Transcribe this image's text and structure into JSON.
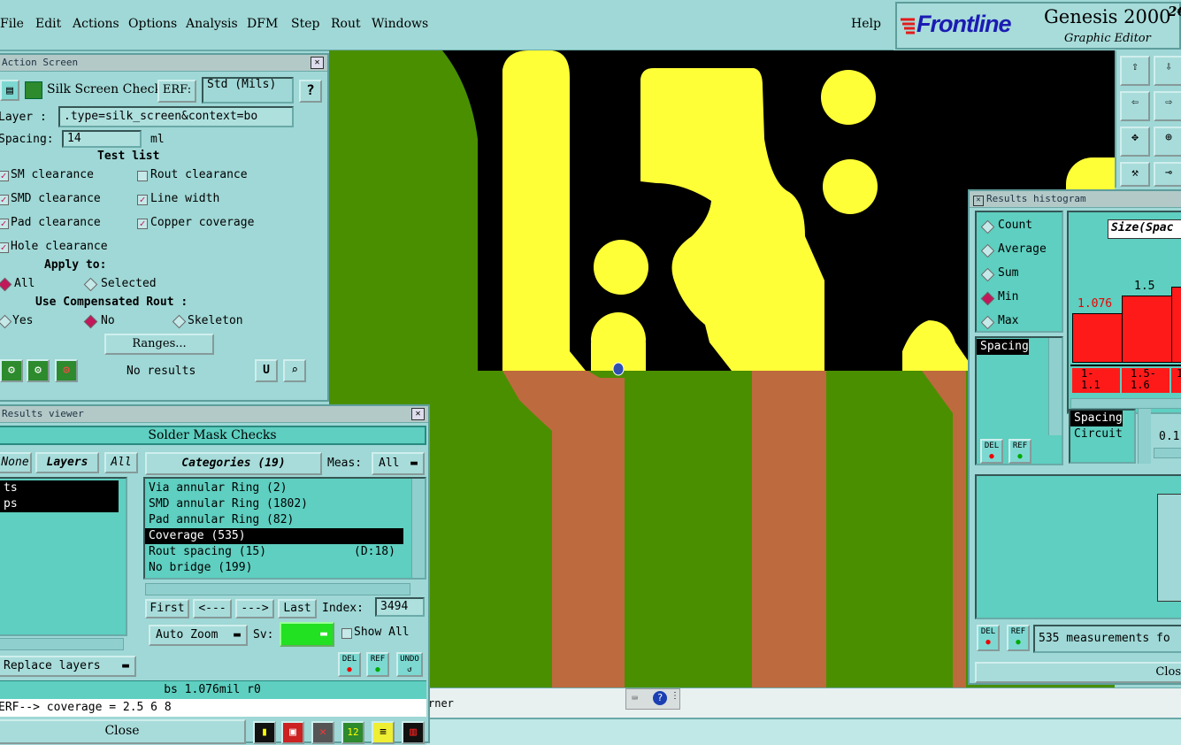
{
  "menubar": {
    "items": [
      "File",
      "Edit",
      "Actions",
      "Options",
      "Analysis",
      "DFM",
      "Step",
      "Rout",
      "Windows"
    ],
    "help": "Help"
  },
  "brand": {
    "logo": "Frontline",
    "product": "Genesis 2000",
    "version_fragment": "2€",
    "subtitle": "Graphic Editor"
  },
  "action_screen": {
    "title": "Action Screen",
    "check_name": "Silk Screen Checks",
    "erf_label": "ERF:",
    "erf_value": "Std (Mils)",
    "help_btn": "?",
    "layer_label": "Layer :",
    "layer_value": ".type=silk_screen&context=bo",
    "spacing_label": "Spacing:",
    "spacing_value": "14",
    "spacing_unit": "ml",
    "test_list_label": "Test list",
    "tests": [
      {
        "label": "SM clearance",
        "checked": true
      },
      {
        "label": "Rout clearance",
        "checked": false
      },
      {
        "label": "SMD clearance",
        "checked": true
      },
      {
        "label": "Line width",
        "checked": true
      },
      {
        "label": "Pad clearance",
        "checked": true
      },
      {
        "label": "Copper coverage",
        "checked": true
      },
      {
        "label": "Hole clearance",
        "checked": true
      }
    ],
    "apply_to_label": "Apply to:",
    "apply_all": "All",
    "apply_selected": "Selected",
    "compensated_label": "Use Compensated Rout :",
    "comp_yes": "Yes",
    "comp_no": "No",
    "comp_skeleton": "Skeleton",
    "ranges_btn": "Ranges...",
    "results_status": "No results"
  },
  "results_viewer": {
    "title": "Results viewer",
    "header": "Solder Mask Checks",
    "none_btn": "None",
    "layers_btn": "Layers",
    "all_btn": "All",
    "categories_btn": "Categories (19)",
    "meas_label": "Meas:",
    "meas_value": "All",
    "layers": [
      "ts",
      "ps"
    ],
    "categories": [
      {
        "label": "Via annular Ring (2)",
        "extra": ""
      },
      {
        "label": "SMD annular Ring (1802)",
        "extra": ""
      },
      {
        "label": "Pad annular Ring (82)",
        "extra": ""
      },
      {
        "label": "Coverage (535)",
        "extra": ""
      },
      {
        "label": "Rout spacing (15)",
        "extra": "(D:18)"
      },
      {
        "label": "No bridge (199)",
        "extra": ""
      }
    ],
    "first_btn": "First",
    "prev_btn": "<---",
    "next_btn": "--->",
    "last_btn": "Last",
    "index_label": "Index:",
    "index_value": "3494",
    "auto_zoom": "Auto Zoom",
    "sv_label": "Sv:",
    "show_all": "Show All",
    "replace_layers": "Replace layers",
    "del_btn": "DEL",
    "ref_btn": "REF",
    "undo_btn": "UNDO",
    "status_line": "bs 1.076mil  r0",
    "erf_line": "ERF--> coverage = 2.5 6 8",
    "close_btn": "Close"
  },
  "histogram": {
    "title": "Results histogram",
    "modes": [
      {
        "label": "Count",
        "selected": false
      },
      {
        "label": "Average",
        "selected": false
      },
      {
        "label": "Sum",
        "selected": false
      },
      {
        "label": "Min",
        "selected": true
      },
      {
        "label": "Max",
        "selected": false
      }
    ],
    "size_label": "Size(Spac",
    "bars": [
      {
        "value_label": "1.076",
        "range": "1-\n1.1",
        "value": 1.076
      },
      {
        "value_label": "1.5",
        "range": "1.5-\n1.6",
        "value": 1.5
      },
      {
        "value_label": "",
        "range": "1",
        "value": 1.5
      }
    ],
    "list1": [
      "Spacing"
    ],
    "list2": [
      "Spacing",
      "Circuit"
    ],
    "slider_value": "0.1",
    "del_btn": "DEL",
    "ref_btn": "REF",
    "measurements": "535 measurements fo",
    "close_btn": "Clos"
  },
  "canvas_status": {
    "text": "rner"
  },
  "colors": {
    "board_green": "#4a8f00",
    "silk_yellow": "#ffff38",
    "copper": "#bd6a3e",
    "bar_red": "#ff1a1a",
    "selection": "#c2185b"
  }
}
